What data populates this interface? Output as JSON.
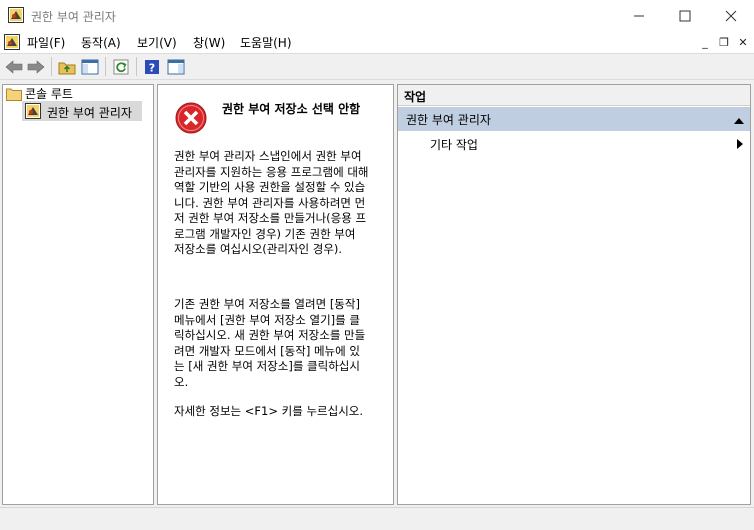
{
  "window": {
    "title": "권한 부여 관리자",
    "controls": {
      "minimize": "—",
      "maximize": "☐",
      "close": "✕"
    }
  },
  "menu": {
    "items": [
      "파일(F)",
      "동작(A)",
      "보기(V)",
      "창(W)",
      "도움말(H)"
    ],
    "mdi": {
      "minimize": "_",
      "restore": "❐",
      "close": "✕"
    }
  },
  "toolbar": {
    "icons": [
      "back-arrow-icon",
      "forward-arrow-icon",
      "up-folder-icon",
      "show-hide-tree-icon",
      "refresh-icon",
      "help-icon",
      "show-hide-action-pane-icon"
    ]
  },
  "tree": {
    "root": "콘솔 루트",
    "child": "권한 부여 관리자"
  },
  "content": {
    "title": "권한 부여 저장소 선택 안함",
    "para1": "권한 부여 관리자 스냅인에서 권한 부여 관리자를 지원하는 응용 프로그램에 대해 역할 기반의 사용 권한을 설정할 수 있습니다. 권한 부여 관리자를 사용하려면 먼저 권한 부여 저장소를 만들거나(응용 프로그램 개발자인 경우) 기존 권한 부여 저장소를 여십시오(관리자인 경우).",
    "para2": "기존 권한 부여 저장소를 열려면 [동작] 메뉴에서 [권한 부여 저장소 열기]를 클릭하십시오. 새 권한 부여 저장소를 만들려면 개발자 모드에서 [동작] 메뉴에 있는 [새 권한 부여 저장소]를 클릭하십시오.",
    "para3": "자세한 정보는 <F1> 키를 누르십시오."
  },
  "actions": {
    "header": "작업",
    "group": "권한 부여 관리자",
    "item": "기타 작업"
  },
  "colors": {
    "group_bg": "#bfcee0",
    "error_red": "#d9262a",
    "tree_selected": "#d9d9d9"
  }
}
